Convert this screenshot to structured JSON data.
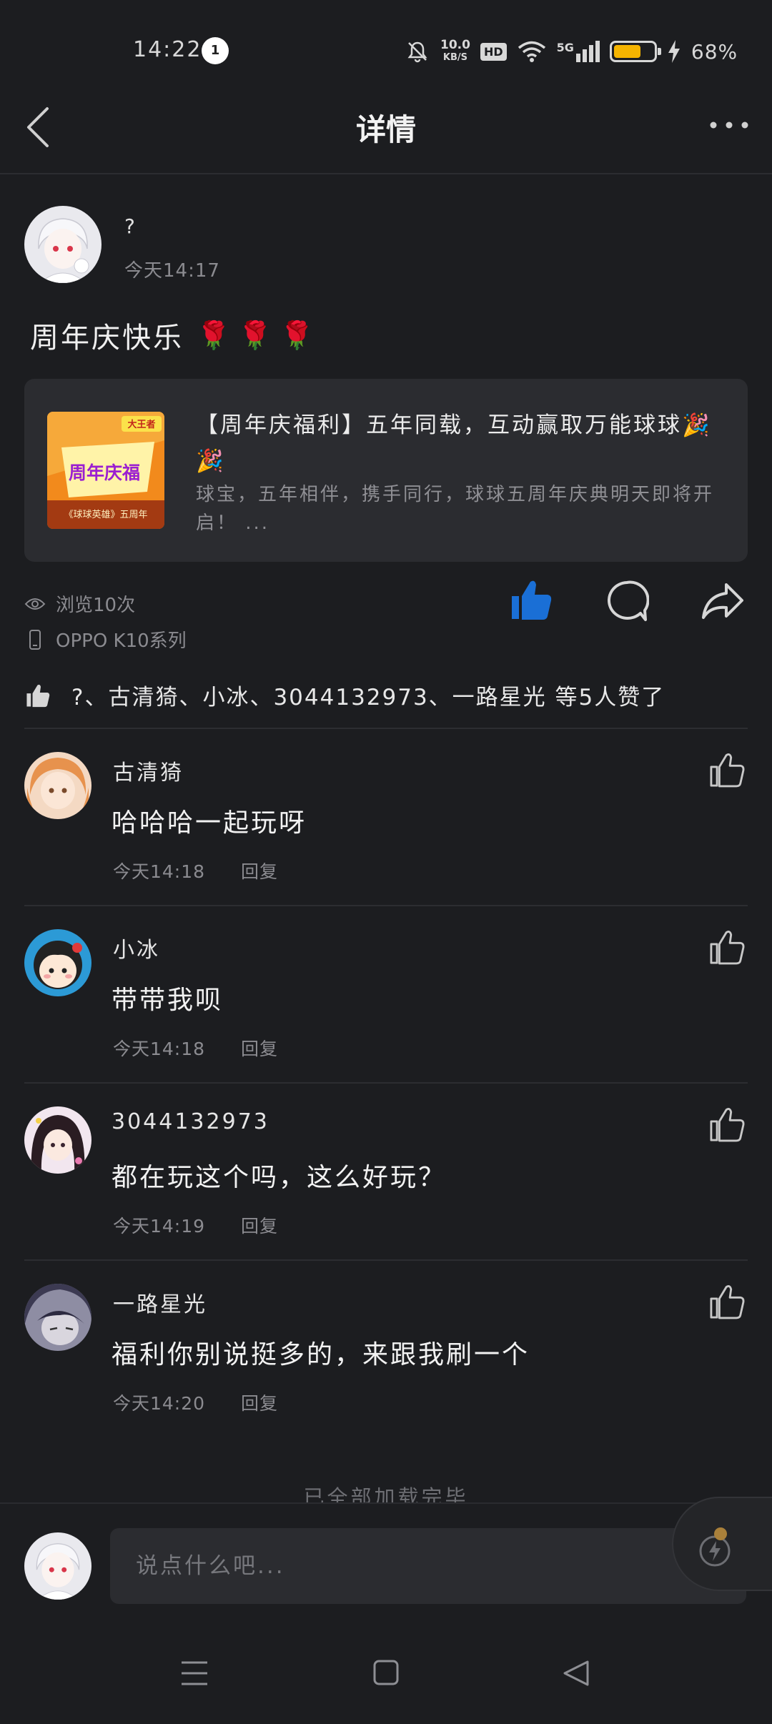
{
  "status_bar": {
    "time": "14:22",
    "notification_badge": "1",
    "net_speed_value": "10.0",
    "net_speed_unit": "KB/S",
    "hd": "HD",
    "signal": "5G",
    "battery_percent": "68%",
    "battery_level": 0.68,
    "battery_color": "#f5b400"
  },
  "header": {
    "title": "详情"
  },
  "post": {
    "author": "?",
    "time": "今天14:17",
    "content": "周年庆快乐",
    "emoji": [
      "🌹",
      "🌹",
      "🌹"
    ],
    "link_card": {
      "title": "【周年庆福利】五年同载，互动赢取万能球球🎉🎉",
      "description": "球宝，五年相伴，携手同行，球球五周年庆典明天即将开启！ ...",
      "thumb_badge": "大王者",
      "thumb_title": "周年庆福",
      "thumb_sub": "《球球英雄》五周年"
    },
    "views": "浏览10次",
    "device": "OPPO K10系列",
    "likers": "?、古清猗、小冰、3044132973、一路星光 等5人赞了",
    "liked": true,
    "like_color": "#1a6fd6"
  },
  "comments": [
    {
      "name": "古清猗",
      "text": "哈哈哈一起玩呀",
      "time": "今天14:18",
      "reply": "回复"
    },
    {
      "name": "小冰",
      "text": "带带我呗",
      "time": "今天14:18",
      "reply": "回复"
    },
    {
      "name": "3044132973",
      "text": "都在玩这个吗，这么好玩？",
      "time": "今天14:19",
      "reply": "回复"
    },
    {
      "name": "一路星光",
      "text": "福利你别说挺多的，来跟我刷一个",
      "time": "今天14:20",
      "reply": "回复"
    }
  ],
  "footer": {
    "end_text": "已全部加载完毕",
    "input_placeholder": "说点什么吧..."
  }
}
